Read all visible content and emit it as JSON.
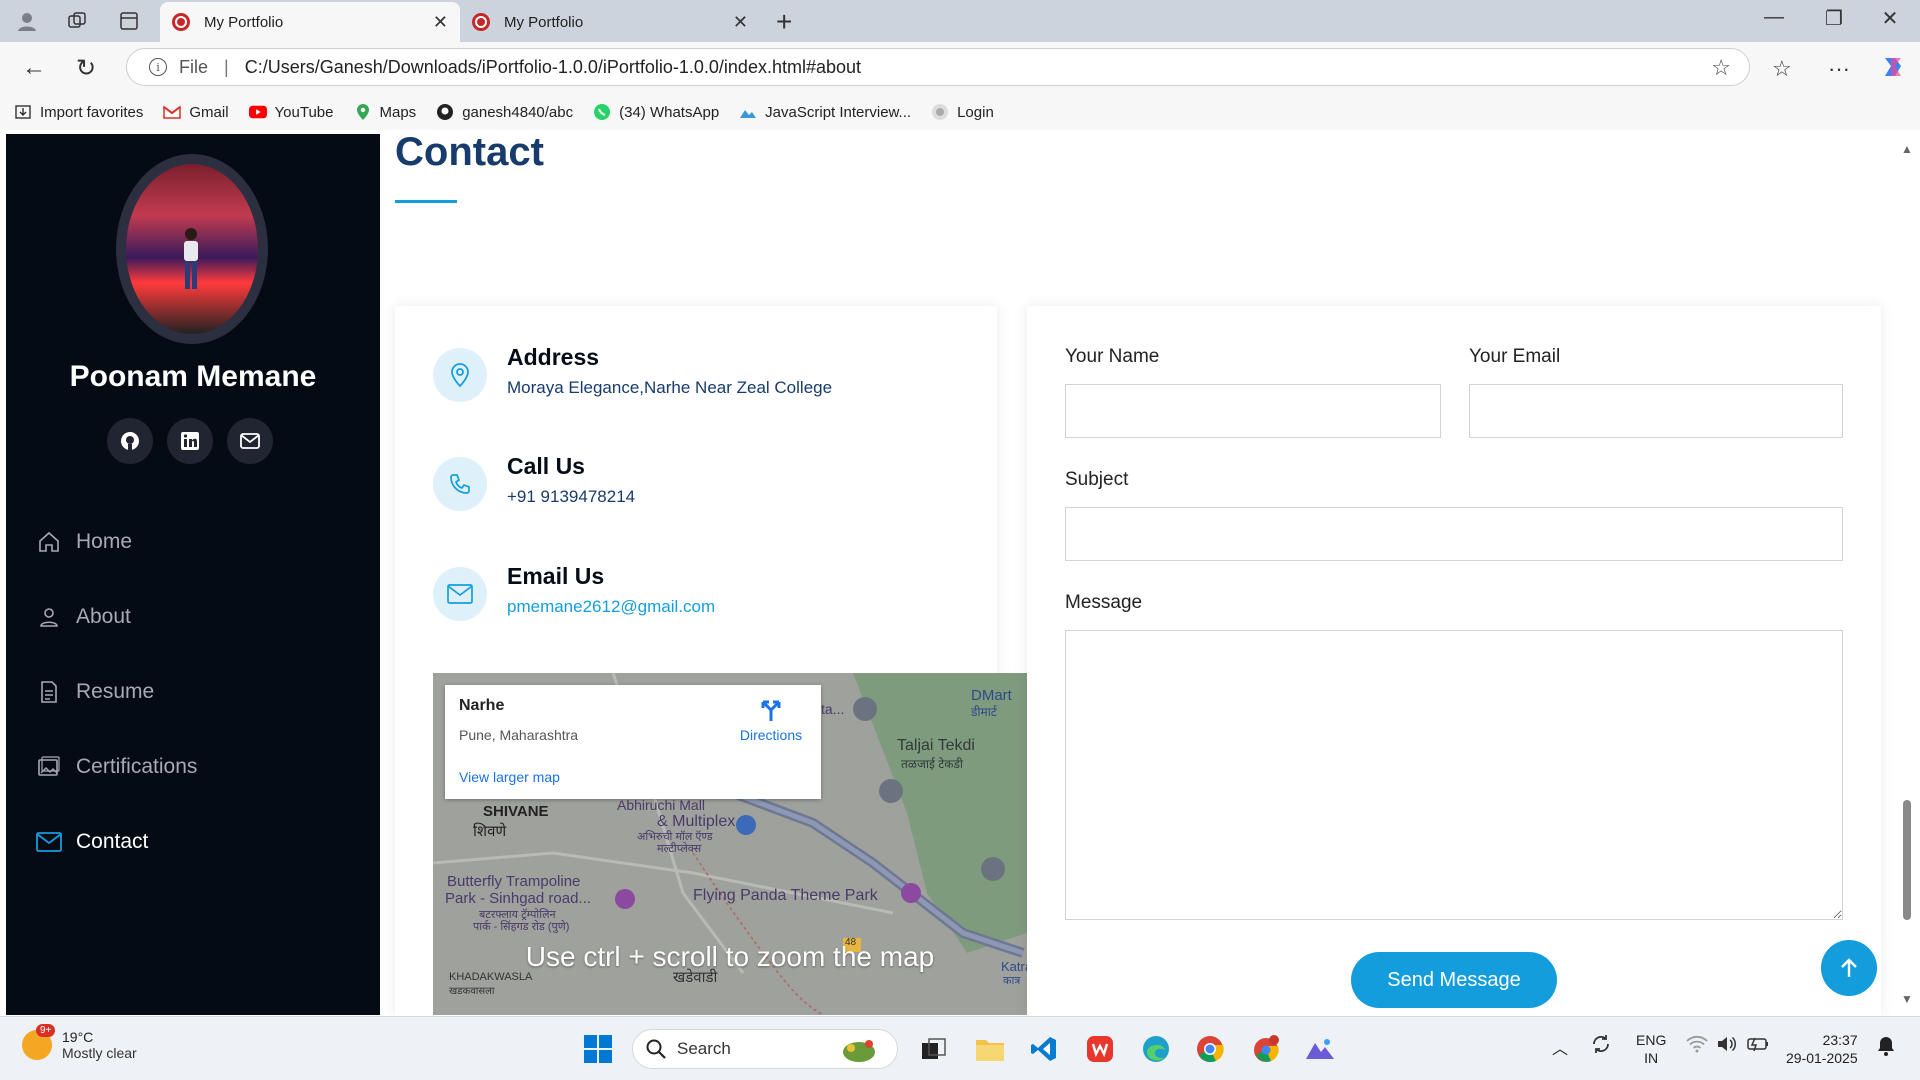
{
  "browser": {
    "tabs": [
      {
        "label": "My Portfolio",
        "active": true
      },
      {
        "label": "My Portfolio",
        "active": false
      }
    ],
    "address": {
      "scheme_label": "File",
      "url": "C:/Users/Ganesh/Downloads/iPortfolio-1.0.0/iPortfolio-1.0.0/index.html#about"
    },
    "favorites": [
      {
        "label": "Import favorites",
        "icon": "import-icon"
      },
      {
        "label": "Gmail",
        "icon": "gmail-icon"
      },
      {
        "label": "YouTube",
        "icon": "youtube-icon"
      },
      {
        "label": "Maps",
        "icon": "maps-icon"
      },
      {
        "label": "ganesh4840/abc",
        "icon": "github-icon"
      },
      {
        "label": "(34) WhatsApp",
        "icon": "whatsapp-icon"
      },
      {
        "label": "JavaScript Interview...",
        "icon": "site-icon"
      },
      {
        "label": "Login",
        "icon": "login-icon"
      }
    ]
  },
  "sidebar": {
    "name": "Poonam Memane",
    "menu": [
      {
        "label": "Home",
        "icon": "home-icon"
      },
      {
        "label": "About",
        "icon": "person-icon"
      },
      {
        "label": "Resume",
        "icon": "file-icon"
      },
      {
        "label": "Certifications",
        "icon": "images-icon"
      },
      {
        "label": "Contact",
        "icon": "envelope-icon",
        "active": true
      }
    ]
  },
  "contact": {
    "title": "Contact",
    "address": {
      "heading": "Address",
      "value": "Moraya Elegance,Narhe Near Zeal College"
    },
    "call": {
      "heading": "Call Us",
      "value": "+91 9139478214"
    },
    "email": {
      "heading": "Email Us",
      "value": "pmemane2612@gmail.com"
    }
  },
  "map": {
    "place": "Narhe",
    "region": "Pune, Maharashtra",
    "directions": "Directions",
    "larger_map": "View larger map",
    "hint": "Use ctrl + scroll to zoom the map",
    "labels": {
      "dmart": "DMart",
      "dmart_local": "डीमार्ट",
      "taljai": "Taljai Tekdi",
      "taljai_local": "तळजाई टेकडी",
      "abhiruchi": "Abhiruchi Mall",
      "multiplex": "& Multiplex",
      "abhiruchi_local": "अभिरुची मॉल ऍण्ड",
      "multiplex_local": "मल्टीप्लेक्स",
      "shivane": "SHIVANE",
      "shivane_local": "शिवणे",
      "butterfly": "Butterfly Trampoline",
      "butterfly2": "Park - Sinhgad road...",
      "butterfly_local": "बटरफ्लाय ट्रॅम्पोलिन",
      "butterfly_local2": "पार्क - सिंहगड रोड (पुणे)",
      "flying": "Flying Panda Theme Park",
      "khadakwasla": "KHADAKWASLA",
      "khadakwasla_local": "खडकवासला",
      "khadewadi": "खडेवाडी",
      "katraj": "Katraj",
      "katraj_local": "कात्र",
      "road": "48",
      "ta": "ta..."
    }
  },
  "form": {
    "name_label": "Your Name",
    "email_label": "Your Email",
    "subject_label": "Subject",
    "message_label": "Message",
    "name_value": "",
    "email_value": "",
    "subject_value": "",
    "message_value": "",
    "submit_label": "Send Message"
  },
  "taskbar": {
    "weather_temp": "19°C",
    "weather_desc": "Mostly clear",
    "weather_badge": "9+",
    "search_placeholder": "Search",
    "lang_1": "ENG",
    "lang_2": "IN",
    "time": "23:37",
    "date": "29-01-2025"
  },
  "colors": {
    "accent": "#149ddd",
    "sidebar_bg": "#040b14",
    "heading": "#173b6c"
  }
}
